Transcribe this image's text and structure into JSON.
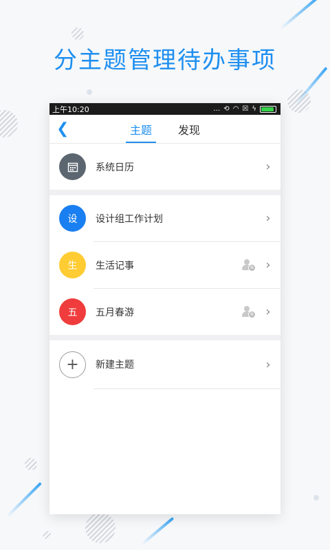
{
  "headline": "分主题管理待办事项",
  "status_bar": {
    "time": "上午10:20",
    "icons": [
      "dots-icon",
      "sync-off-icon",
      "wifi-icon",
      "sim-icon",
      "charging-icon",
      "battery-icon"
    ]
  },
  "nav": {
    "tabs": [
      {
        "label": "主题",
        "active": true
      },
      {
        "label": "发现",
        "active": false
      }
    ]
  },
  "list": [
    {
      "label": "系统日历",
      "avatar_text": "",
      "avatar_icon": "calendar-icon",
      "color": "#5b6670",
      "shared": false
    },
    {
      "label": "设计组工作计划",
      "avatar_text": "设",
      "color": "#1a7ff0",
      "shared": false
    },
    {
      "label": "生活记事",
      "avatar_text": "生",
      "color": "#ffcc33",
      "shared": true
    },
    {
      "label": "五月春游",
      "avatar_text": "五",
      "color": "#f03c3c",
      "shared": true
    },
    {
      "label": "新建主题",
      "avatar_text": "+",
      "color": "#ffffff",
      "shared": false
    }
  ],
  "colors": {
    "accent": "#1e8ff0"
  }
}
